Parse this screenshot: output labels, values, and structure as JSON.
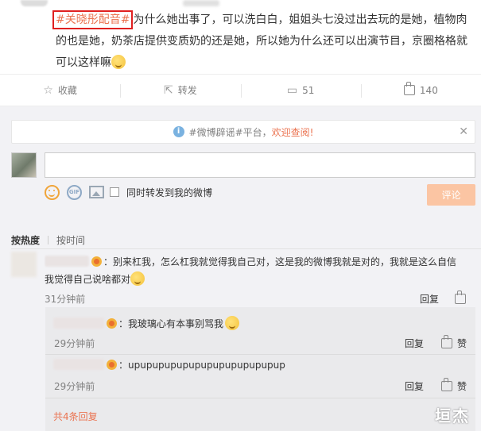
{
  "post": {
    "hashtag": "#关晓彤配音#",
    "text_after_hashtag": "为什么她出事了，可以洗白白，姐姐头七没过出去玩的是她，植物肉的也是她，奶茶店提供变质奶的还是她，所以她为什么还可以出演节目，京圈格格就可以这样嘛"
  },
  "actions": {
    "collect": "收藏",
    "repost": "转发",
    "comment_count": "51",
    "like_count": "140"
  },
  "notice": {
    "prefix": "#微博辟谣#平台，",
    "highlight": "欢迎查阅!"
  },
  "composer": {
    "also_repost_label": "同时转发到我的微博",
    "submit_label": "评论"
  },
  "sort": {
    "by_hot": "按热度",
    "by_time": "按时间"
  },
  "comment": {
    "line1": "：别来杠我，怎么杠我就觉得我自己对，这是我的微博我就是对的，我就是这么自信",
    "line2": "我觉得自己说啥都对",
    "time": "31分钟前",
    "reply_label": "回复"
  },
  "replies": [
    {
      "text": "：我玻璃心有本事别骂我",
      "time": "29分钟前",
      "reply_label": "回复",
      "like_label": "赞"
    },
    {
      "text": "：upupupupupupupupupupupupup",
      "time": "29分钟前",
      "reply_label": "回复",
      "like_label": "赞"
    }
  ],
  "more_replies": "共4条回复",
  "watermark": "垣杰"
}
